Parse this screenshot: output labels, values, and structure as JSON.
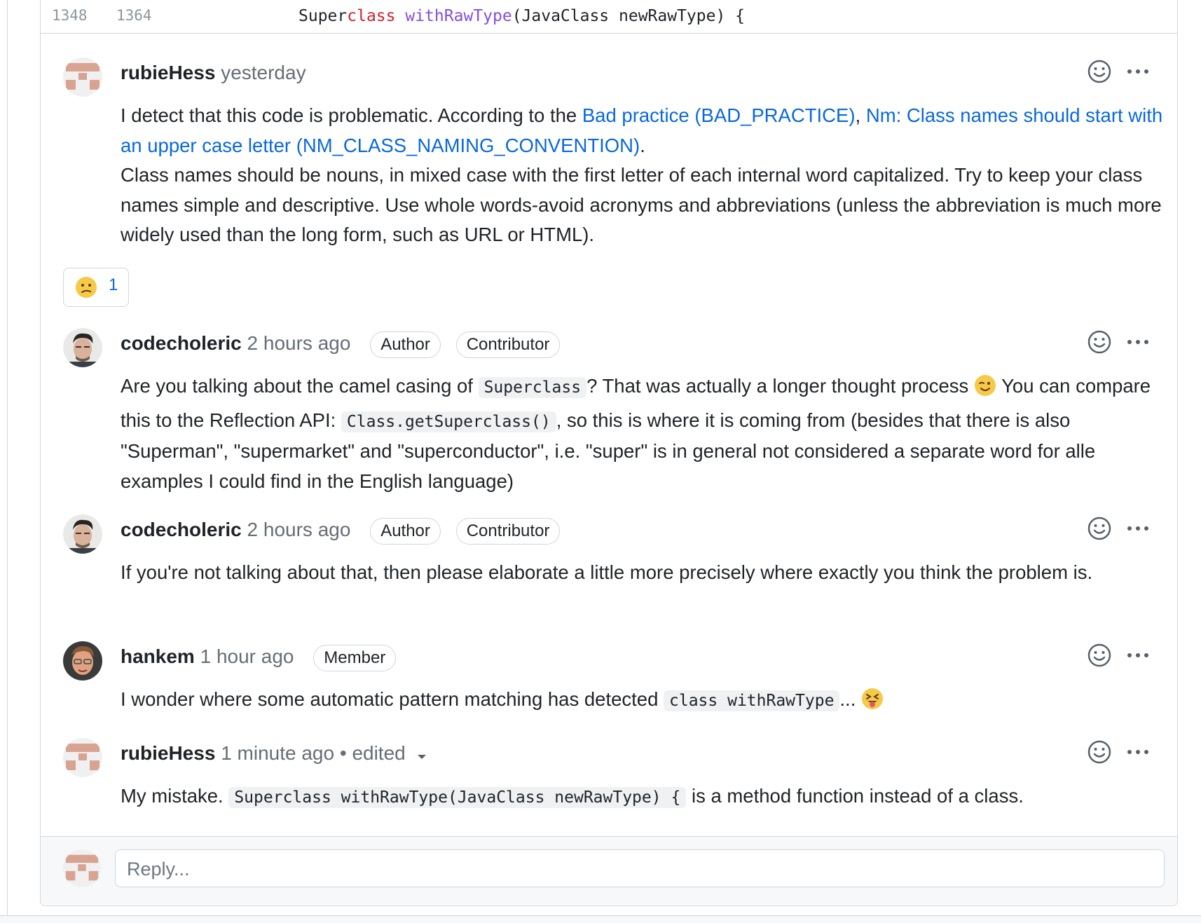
{
  "diff": {
    "old_line": "1348",
    "new_line": "1364",
    "code": {
      "part1": "Super",
      "part2": "class",
      "part3": " ",
      "part4": "withRawType",
      "part5": "(JavaClass newRawType) {"
    }
  },
  "comments": [
    {
      "author": "rubieHess",
      "time": "yesterday",
      "text_prefix": "I detect that this code is problematic. According to the ",
      "link1": "Bad practice (BAD_PRACTICE)",
      "sep": ", ",
      "link2": "Nm: Class names should start with an upper case letter (NM_CLASS_NAMING_CONVENTION)",
      "text_suffix": ".",
      "paragraph2": "Class names should be nouns, in mixed case with the first letter of each internal word capitalized. Try to keep your class names simple and descriptive. Use whole words-avoid acronyms and abbreviations (unless the abbreviation is much more widely used than the long form, such as URL or HTML).",
      "reaction": {
        "emoji": "confused-face",
        "count": "1"
      }
    },
    {
      "author": "codecholeric",
      "time": "2 hours ago",
      "badges": [
        "Author",
        "Contributor"
      ],
      "t1": "Are you talking about the camel casing of ",
      "c1": "Superclass",
      "t2": "? That was actually a longer thought process ",
      "emoji": "winking-face",
      "t3": " You can compare this to the Reflection API: ",
      "c2": "Class.getSuperclass()",
      "t4": ", so this is where it is coming from (besides that there is also \"Superman\", \"supermarket\" and \"superconductor\", i.e. \"super\" is in general not considered a separate word for alle examples I could find in the English language)"
    },
    {
      "author": "codecholeric",
      "time": "2 hours ago",
      "badges": [
        "Author",
        "Contributor"
      ],
      "text": "If you're not talking about that, then please elaborate a little more precisely where exactly you think the problem is."
    },
    {
      "author": "hankem",
      "time": "1 hour ago",
      "badges": [
        "Member"
      ],
      "t1": "I wonder where some automatic pattern matching has detected ",
      "c1": "class withRawType",
      "t2": "... ",
      "emoji": "squinting-face-with-tongue"
    },
    {
      "author": "rubieHess",
      "time": "1 minute ago",
      "edited": "• edited",
      "t1": "My mistake. ",
      "c1": "Superclass withRawType(JavaClass newRawType) {",
      "t2": " is a method function instead of a class."
    }
  ],
  "reply": {
    "placeholder": "Reply..."
  },
  "icons": {
    "add_reaction": "smiley-icon",
    "more_actions": "kebab-horizontal-icon",
    "edited_dropdown": "triangle-down-icon"
  },
  "colors": {
    "link": "#0969da",
    "muted": "#656d76",
    "border": "#d0d7de",
    "keyword": "#cf222e",
    "function": "#8250df"
  }
}
